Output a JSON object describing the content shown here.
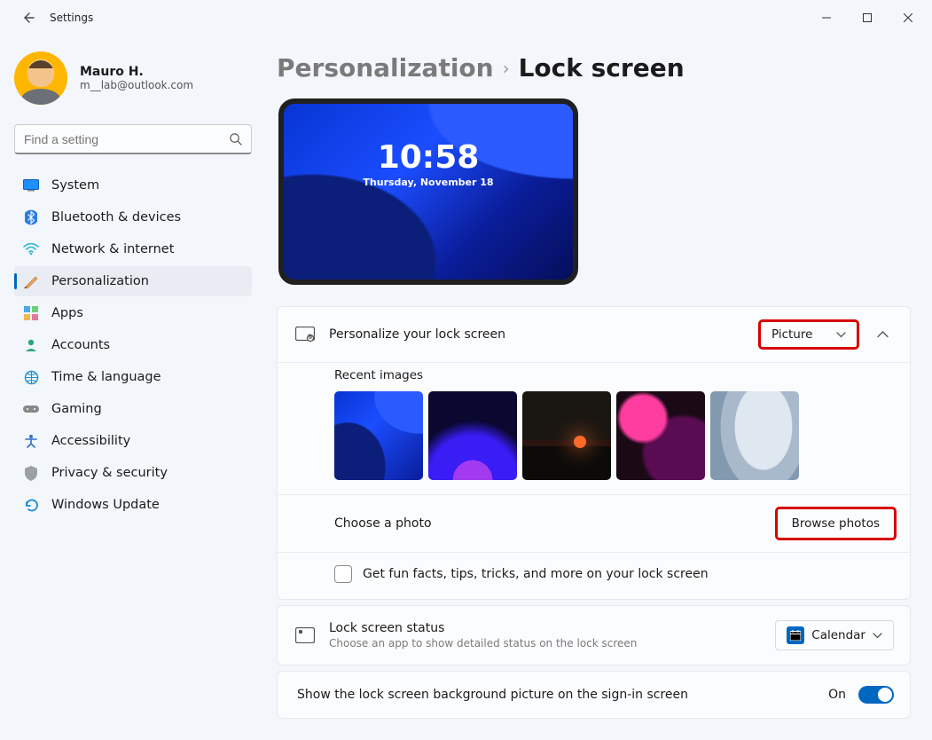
{
  "window": {
    "title": "Settings"
  },
  "profile": {
    "name": "Mauro H.",
    "email": "m__lab@outlook.com"
  },
  "search": {
    "placeholder": "Find a setting"
  },
  "sidebar": {
    "items": [
      {
        "label": "System"
      },
      {
        "label": "Bluetooth & devices"
      },
      {
        "label": "Network & internet"
      },
      {
        "label": "Personalization"
      },
      {
        "label": "Apps"
      },
      {
        "label": "Accounts"
      },
      {
        "label": "Time & language"
      },
      {
        "label": "Gaming"
      },
      {
        "label": "Accessibility"
      },
      {
        "label": "Privacy & security"
      },
      {
        "label": "Windows Update"
      }
    ],
    "active_index": 3
  },
  "breadcrumb": {
    "parent": "Personalization",
    "current": "Lock screen"
  },
  "preview": {
    "time": "10:58",
    "date": "Thursday, November 18"
  },
  "personalize": {
    "title": "Personalize your lock screen",
    "dropdown_value": "Picture",
    "recent_label": "Recent images",
    "choose_label": "Choose a photo",
    "browse_label": "Browse photos",
    "funfacts_label": "Get fun facts, tips, tricks, and more on your lock screen",
    "funfacts_checked": false
  },
  "status": {
    "title": "Lock screen status",
    "subtitle": "Choose an app to show detailed status on the lock screen",
    "app": "Calendar"
  },
  "signin": {
    "label": "Show the lock screen background picture on the sign-in screen",
    "state": "On",
    "enabled": true
  }
}
